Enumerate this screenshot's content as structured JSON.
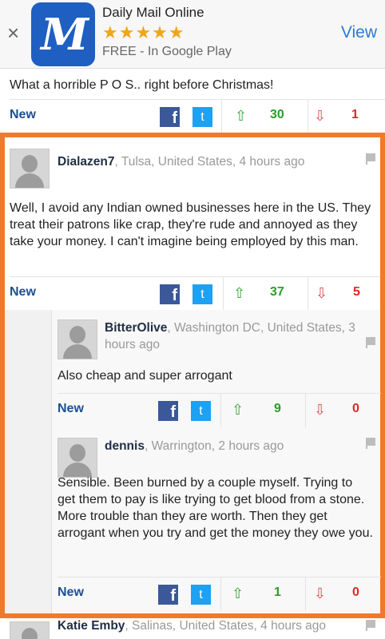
{
  "banner": {
    "close_glyph": "×",
    "app_name": "Daily Mail Online",
    "logo_text": "M",
    "rating": 4.5,
    "stars_display": "★★★★★",
    "store_text": "FREE - In Google Play",
    "view_label": "View",
    "brand_color": "#1f5fc2"
  },
  "top_comment": {
    "text": "What a horrible P O S.. right before Christmas!",
    "new_label": "New",
    "upvotes": "30",
    "downvotes": "1"
  },
  "comments": [
    {
      "user": "Dialazen7",
      "meta": ", Tulsa, United States, 4 hours ago",
      "text": "Well, I avoid any Indian owned businesses here in the US. They treat their patrons like crap, they're rude and annoyed as they take your money. I can't imagine being employed by this man.",
      "new_label": "New",
      "upvotes": "37",
      "downvotes": "5"
    },
    {
      "user": "BitterOlive",
      "meta": ", Washington DC, United States, 3 hours ago",
      "text": "Also cheap and super arrogant",
      "new_label": "New",
      "upvotes": "9",
      "downvotes": "0"
    },
    {
      "user": "dennis",
      "meta": ", Warrington, 2 hours ago",
      "text": "Sensible. Been burned by a couple myself. Trying to get them to pay is like trying to get blood from a stone. More trouble than they are worth. Then they get arrogant when you try and get the money they owe you.",
      "new_label": "New",
      "upvotes": "1",
      "downvotes": "0"
    },
    {
      "user": "Katie Emby",
      "meta": ", Salinas, United States, 4 hours ago"
    }
  ],
  "icons": {
    "facebook": "f",
    "twitter": "t",
    "upvote": "⇧",
    "downvote": "⇩"
  },
  "colors": {
    "highlight": "#f07a2b",
    "upvote": "#2a9d2a",
    "downvote": "#d62b2b",
    "facebook": "#3b5998",
    "twitter": "#1da1f2"
  }
}
